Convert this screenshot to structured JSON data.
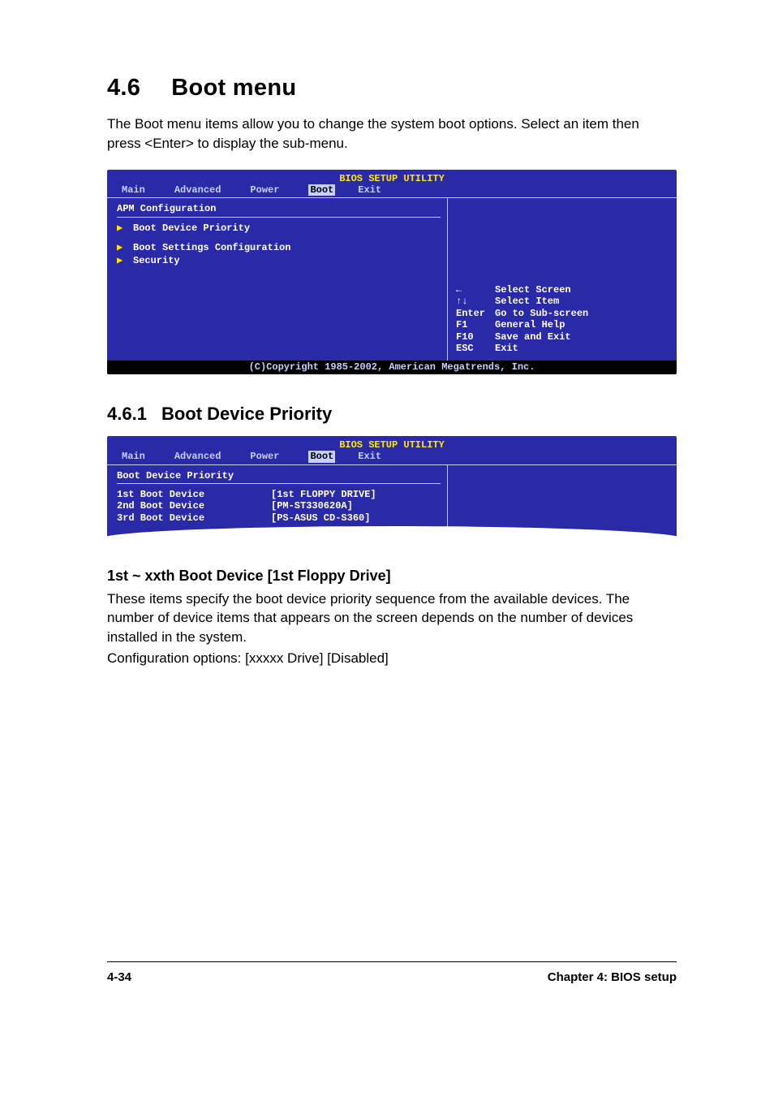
{
  "heading": {
    "number": "4.6",
    "title": "Boot menu"
  },
  "intro": "The Boot menu items allow you to change the system boot options. Select an item then press <Enter> to display the sub-menu.",
  "bios1": {
    "title": "BIOS SETUP UTILITY",
    "tabs": [
      "Main",
      "Advanced",
      "Power",
      "Boot",
      "Exit"
    ],
    "section_label": "APM Configuration",
    "items": [
      "Boot Device Priority",
      "Boot Settings Configuration",
      "Security"
    ],
    "help": [
      {
        "key": "←",
        "desc": "Select Screen"
      },
      {
        "key": "↑↓",
        "desc": "Select Item"
      },
      {
        "key": "Enter",
        "desc": "Go to Sub-screen"
      },
      {
        "key": "F1",
        "desc": "General Help"
      },
      {
        "key": "F10",
        "desc": "Save and Exit"
      },
      {
        "key": "ESC",
        "desc": "Exit"
      }
    ],
    "footer": "(C)Copyright 1985-2002, American Megatrends, Inc."
  },
  "sub": {
    "number": "4.6.1",
    "title": "Boot Device Priority"
  },
  "bios2": {
    "title": "BIOS SETUP UTILITY",
    "tabs": [
      "Main",
      "Advanced",
      "Power",
      "Boot",
      "Exit"
    ],
    "section_label": "Boot Device Priority",
    "rows": [
      {
        "label": "1st Boot Device",
        "value": "[1st FLOPPY DRIVE]"
      },
      {
        "label": "2nd Boot Device",
        "value": "[PM-ST330620A]"
      },
      {
        "label": "3rd Boot Device",
        "value": "[PS-ASUS CD-S360]"
      }
    ]
  },
  "topic": {
    "heading": "1st ~ xxth Boot Device [1st Floppy Drive]",
    "p1": "These items specify the boot device priority sequence from the available devices. The number of device items that appears on the screen depends on the number of devices installed in the system.",
    "p2": "Configuration options: [xxxxx Drive] [Disabled]"
  },
  "footer": {
    "page": "4-34",
    "chapter": "Chapter 4: BIOS setup"
  }
}
